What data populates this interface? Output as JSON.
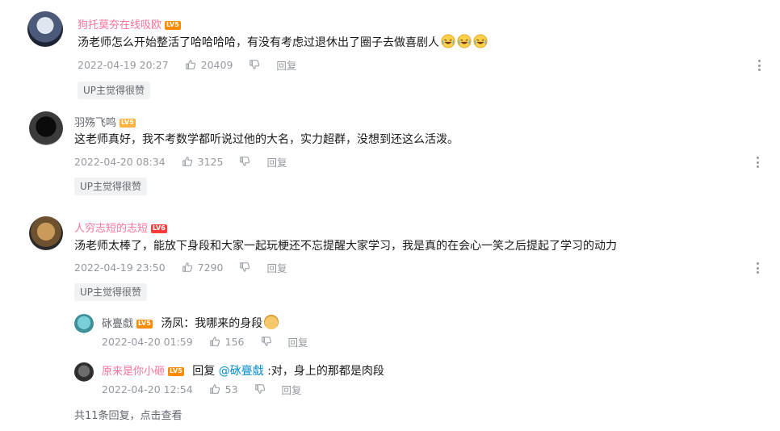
{
  "comments": [
    {
      "username": "狗托莫夯在线吸欧",
      "level": "LV5",
      "text": "汤老师怎么开始整活了哈哈哈哈，有没有考虑过退休出了圈子去做喜剧人",
      "date": "2022-04-19 20:27",
      "likes": "20409",
      "reply_label": "回复",
      "badge": "UP主觉得很赞"
    },
    {
      "username": "羽殇飞鸣",
      "level": "LV5",
      "text": "这老师真好，我不考数学都听说过他的大名，实力超群，没想到还这么活泼。",
      "date": "2022-04-20 08:34",
      "likes": "3125",
      "reply_label": "回复",
      "badge": "UP主觉得很赞"
    },
    {
      "username": "人穷志短的志短",
      "level": "LV6",
      "text": "汤老师太棒了，能放下身段和大家一起玩梗还不忘提醒大家学习，我是真的在会心一笑之后提起了学习的动力",
      "date": "2022-04-19 23:50",
      "likes": "7290",
      "reply_label": "回复",
      "badge": "UP主觉得很赞"
    }
  ],
  "replies": [
    {
      "username": "砯亹戱",
      "level": "LV5",
      "text": "汤凤：我哪来的身段",
      "date": "2022-04-20 01:59",
      "likes": "156",
      "reply_label": "回复"
    },
    {
      "username": "原来是你小砸",
      "level": "LV5",
      "reply_prefix": "回复",
      "mention": "@砯亹戱",
      "text": ":对，身上的那都是肉段",
      "date": "2022-04-20 12:54",
      "likes": "53",
      "reply_label": "回复"
    }
  ],
  "footer": {
    "replies_text": "共11条回复，",
    "view_link": "点击查看"
  },
  "colors": {
    "vip_name": "#fb7299",
    "mention": "#008ac5",
    "meta": "#9499a0"
  },
  "icons": [
    "like-icon",
    "dislike-icon",
    "more-icon",
    "laugh-cry-emoji",
    "doge-emoji"
  ]
}
